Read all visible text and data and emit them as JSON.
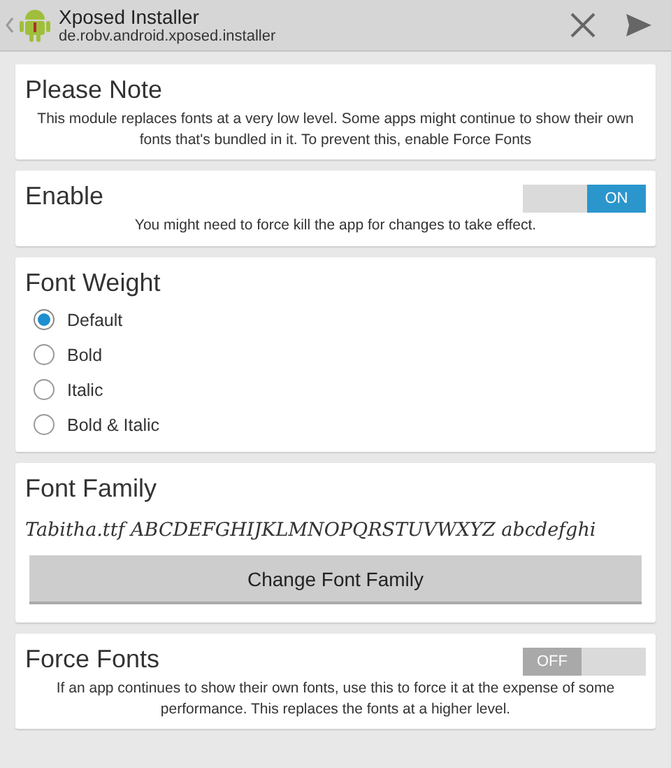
{
  "action_bar": {
    "title": "Xposed Installer",
    "subtitle": "de.robv.android.xposed.installer"
  },
  "cards": [
    {
      "kind": "note",
      "title": "Please Note",
      "text": "This module replaces fonts at a very low level. Some apps might continue to show their own fonts that's bundled in it. To prevent this, enable Force Fonts"
    },
    {
      "kind": "switch",
      "title": "Enable",
      "on": true,
      "switch_label": "ON",
      "text": "You might need to force kill the app for changes to take effect."
    },
    {
      "kind": "radio",
      "title": "Font Weight",
      "options": [
        {
          "label": "Default",
          "selected": true
        },
        {
          "label": "Bold",
          "selected": false
        },
        {
          "label": "Italic",
          "selected": false
        },
        {
          "label": "Bold & Italic",
          "selected": false
        }
      ]
    },
    {
      "kind": "font",
      "title": "Font Family",
      "sample": "Tabitha.ttf  ABCDEFGHIJKLMNOPQRSTUVWXYZ abcdefghi",
      "button": "Change Font Family"
    },
    {
      "kind": "switch",
      "title": "Force Fonts",
      "on": false,
      "switch_label": "OFF",
      "text": "If an app continues to show their own fonts, use this to force it at the expense of some performance. This replaces the fonts at a higher level."
    }
  ]
}
